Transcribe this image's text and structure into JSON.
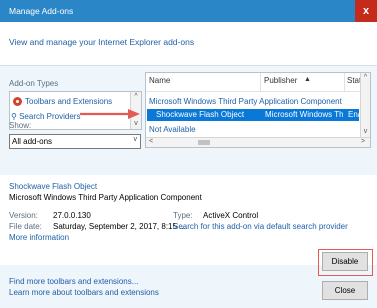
{
  "window": {
    "title": "Manage Add-ons",
    "close_glyph": "x"
  },
  "header": {
    "description": "View and manage your Internet Explorer add-ons"
  },
  "left": {
    "types_label": "Add-on Types",
    "types": [
      {
        "label": "Toolbars and Extensions",
        "icon": "toolbar-gear-icon"
      }
    ],
    "search_link": "Search Providers",
    "show_label": "Show:",
    "show_value": "All add-ons"
  },
  "grid": {
    "columns": [
      "Name",
      "Publisher",
      "Statu"
    ],
    "sort_glyph": "▲",
    "group": "Microsoft Windows Third Party Application Component",
    "selected_row": {
      "name": "Shockwave Flash Object",
      "publisher": "Microsoft Windows Third...",
      "status": "Enal"
    },
    "other_row": "Not Available"
  },
  "details": {
    "name": "Shockwave Flash Object",
    "publisher": "Microsoft Windows Third Party Application Component",
    "version_label": "Version:",
    "version": "27.0.0.130",
    "type_label": "Type:",
    "type": "ActiveX Control",
    "filedate_label": "File date:",
    "filedate": "Saturday, September 2, 2017, 8:15 ...",
    "search_link": "Search for this add-on via default search provider",
    "more_info": "More information"
  },
  "footer": {
    "find_more": "Find more toolbars and extensions...",
    "learn_more": "Learn more about toolbars and extensions",
    "disable_label": "Disable",
    "close_label": "Close"
  },
  "colors": {
    "title_bar": "#2b86c8",
    "close": "#c42b1c",
    "selection": "#0a78d7",
    "link": "#1f5fa8",
    "annotation": "#e35b52"
  }
}
